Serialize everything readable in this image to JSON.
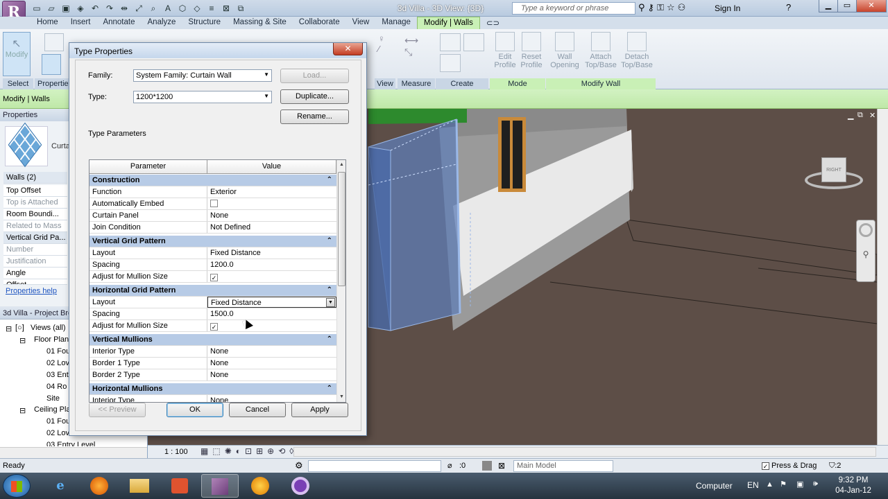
{
  "window": {
    "title": "3d Villa - 3D View: {3D}",
    "search_placeholder": "Type a keyword or phrase",
    "sign_in": "Sign In",
    "help": "?"
  },
  "ribbon_tabs": [
    "Home",
    "Insert",
    "Annotate",
    "Analyze",
    "Structure",
    "Massing & Site",
    "Collaborate",
    "View",
    "Manage",
    "Modify | Walls"
  ],
  "ribbon": {
    "modify_label": "Modify",
    "select_label": "Select",
    "properties_label": "Propertie",
    "view_label": "View",
    "measure_label": "Measure",
    "create_label": "Create",
    "mode_label": "Mode",
    "modify_wall_label": "Modify Wall",
    "tools": [
      {
        "label1": "Edit",
        "label2": "Profile"
      },
      {
        "label1": "Reset",
        "label2": "Profile"
      },
      {
        "label1": "Wall",
        "label2": "Opening"
      },
      {
        "label1": "Attach",
        "label2": "Top/Base"
      },
      {
        "label1": "Detach",
        "label2": "Top/Base"
      }
    ]
  },
  "context_bar": {
    "label": "Modify | Walls"
  },
  "properties": {
    "title": "Properties",
    "type_name": "Curta",
    "selection": "Walls (2)",
    "rows": [
      {
        "label": "Top Offset",
        "dim": false
      },
      {
        "label": "Top is Attached",
        "dim": true
      },
      {
        "label": "Room Boundi...",
        "dim": false
      },
      {
        "label": "Related to Mass",
        "dim": true
      },
      {
        "label": "Vertical Grid Pa...",
        "dim": false
      },
      {
        "label": "Number",
        "dim": true
      },
      {
        "label": "Justification",
        "dim": true
      },
      {
        "label": "Angle",
        "dim": false
      },
      {
        "label": "Offset",
        "dim": false
      }
    ],
    "help_link": "Properties help"
  },
  "browser": {
    "title": "3d Villa - Project Bro",
    "items": [
      {
        "label": "Views (all)",
        "icon": "[○]"
      },
      {
        "label": "Floor Plan",
        "icon": ""
      },
      {
        "label": "01 Fou",
        "icon": ""
      },
      {
        "label": "02 Lov",
        "icon": ""
      },
      {
        "label": "03 Ent",
        "icon": ""
      },
      {
        "label": "04 Ro",
        "icon": ""
      },
      {
        "label": "Site",
        "icon": ""
      },
      {
        "label": "Ceiling Pla",
        "icon": ""
      },
      {
        "label": "01 Fou",
        "icon": ""
      },
      {
        "label": "02 Lov",
        "icon": ""
      },
      {
        "label": "03 Entry Level",
        "icon": ""
      }
    ]
  },
  "dialog": {
    "title": "Type Properties",
    "close": "✕",
    "family_label": "Family:",
    "family_value": "System Family: Curtain Wall",
    "type_label": "Type:",
    "type_value": "1200*1200",
    "load_btn": "Load...",
    "duplicate_btn": "Duplicate...",
    "rename_btn": "Rename...",
    "type_params_label": "Type Parameters",
    "col_parameter": "Parameter",
    "col_value": "Value",
    "groups": [
      {
        "name": "Construction",
        "rows": [
          {
            "p": "Function",
            "v": "Exterior",
            "check": false
          },
          {
            "p": "Automatically Embed",
            "v": "",
            "check": true,
            "checked": false
          },
          {
            "p": "Curtain Panel",
            "v": "None",
            "check": false
          },
          {
            "p": "Join Condition",
            "v": "Not Defined",
            "check": false
          }
        ]
      },
      {
        "name": "Vertical Grid Pattern",
        "rows": [
          {
            "p": "Layout",
            "v": "Fixed Distance",
            "check": false
          },
          {
            "p": "Spacing",
            "v": "1200.0",
            "check": false
          },
          {
            "p": "Adjust for Mullion Size",
            "v": "",
            "check": true,
            "checked": true
          }
        ]
      },
      {
        "name": "Horizontal Grid Pattern",
        "rows": [
          {
            "p": "Layout",
            "v": "Fixed Distance",
            "check": false,
            "editing": true
          },
          {
            "p": "Spacing",
            "v": "1500.0",
            "check": false
          },
          {
            "p": "Adjust for Mullion Size",
            "v": "",
            "check": true,
            "checked": true
          }
        ]
      },
      {
        "name": "Vertical Mullions",
        "rows": [
          {
            "p": "Interior Type",
            "v": "None",
            "check": false
          },
          {
            "p": "Border 1 Type",
            "v": "None",
            "check": false
          },
          {
            "p": "Border 2 Type",
            "v": "None",
            "check": false
          }
        ]
      },
      {
        "name": "Horizontal Mullions",
        "rows": [
          {
            "p": "Interior Type",
            "v": "None",
            "check": false
          }
        ]
      }
    ],
    "preview_btn": "<< Preview",
    "ok_btn": "OK",
    "cancel_btn": "Cancel",
    "apply_btn": "Apply"
  },
  "view_control": {
    "scale": "1 : 100"
  },
  "status": {
    "text": "Ready",
    "count": ":0",
    "model": "Main Model",
    "press_drag": "Press & Drag",
    "filter": ":2"
  },
  "viewcube": {
    "face": "RIGHT"
  },
  "taskbar": {
    "tray_computer": "Computer",
    "tray_lang": "EN",
    "time": "9:32 PM",
    "date": "04-Jan-12"
  },
  "colors": {
    "accent_green": "#c9f0b6",
    "group_header": "#b7cbe6",
    "viewport_ground": "#5d4e47"
  }
}
